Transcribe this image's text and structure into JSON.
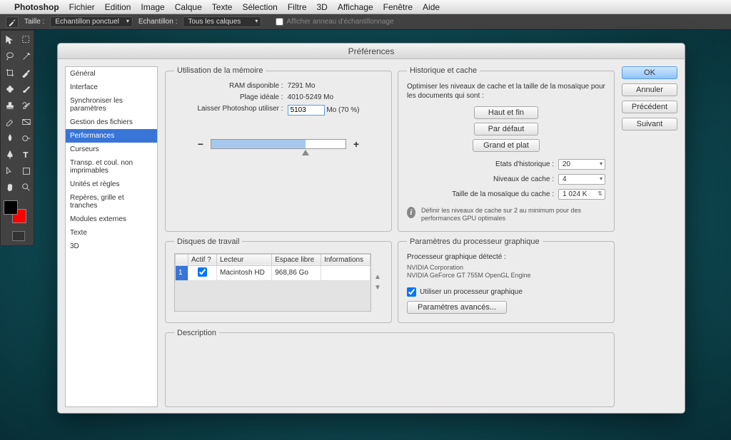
{
  "menubar": {
    "app": "Photoshop",
    "items": [
      "Fichier",
      "Edition",
      "Image",
      "Calque",
      "Texte",
      "Sélection",
      "Filtre",
      "3D",
      "Affichage",
      "Fenêtre",
      "Aide"
    ]
  },
  "optbar": {
    "size_label": "Taille :",
    "size_value": "Echantillon ponctuel",
    "sample_label": "Echantillon :",
    "sample_value": "Tous les calques",
    "ring_label": "Afficher anneau d'échantillonnage"
  },
  "dialog": {
    "title": "Préférences",
    "sidebar": [
      "Général",
      "Interface",
      "Synchroniser les paramètres",
      "Gestion des fichiers",
      "Performances",
      "Curseurs",
      "Transp. et coul. non imprimables",
      "Unités et règles",
      "Repères, grille et tranches",
      "Modules externes",
      "Texte",
      "3D"
    ],
    "sidebar_selected": 4,
    "memory": {
      "legend": "Utilisation de la mémoire",
      "ram_label": "RAM disponible :",
      "ram_value": "7291 Mo",
      "range_label": "Plage idéale :",
      "range_value": "4010-5249 Mo",
      "let_label": "Laisser Photoshop utiliser :",
      "let_value": "5103",
      "let_unit": "Mo (70 %)",
      "slider_pct": 70
    },
    "history": {
      "legend": "Historique et cache",
      "intro": "Optimiser les niveaux de cache et la taille de la mosaïque pour les documents qui sont :",
      "btn1": "Haut et fin",
      "btn2": "Par défaut",
      "btn3": "Grand et plat",
      "states_label": "Etats d'historique :",
      "states_value": "20",
      "levels_label": "Niveaux de cache :",
      "levels_value": "4",
      "tile_label": "Taille de la mosaïque du cache :",
      "tile_value": "1 024 K",
      "info": "Définir les niveaux de cache sur 2 au minimum pour des performances GPU optimales"
    },
    "disk": {
      "legend": "Disques de travail",
      "col_active": "Actif ?",
      "col_reader": "Lecteur",
      "col_free": "Espace libre",
      "col_info": "Informations",
      "row_num": "1",
      "row_reader": "Macintosh HD",
      "row_free": "968,86 Go",
      "row_info": ""
    },
    "gpu": {
      "legend": "Paramètres du processeur graphique",
      "detected_label": "Processeur graphique détecté :",
      "vendor": "NVIDIA Corporation",
      "model": "NVIDIA GeForce GT 755M OpenGL Engine",
      "use_label": "Utiliser un processeur graphique",
      "advanced_btn": "Paramètres avancés..."
    },
    "desc": {
      "legend": "Description"
    },
    "buttons": {
      "ok": "OK",
      "cancel": "Annuler",
      "prev": "Précédent",
      "next": "Suivant"
    }
  }
}
